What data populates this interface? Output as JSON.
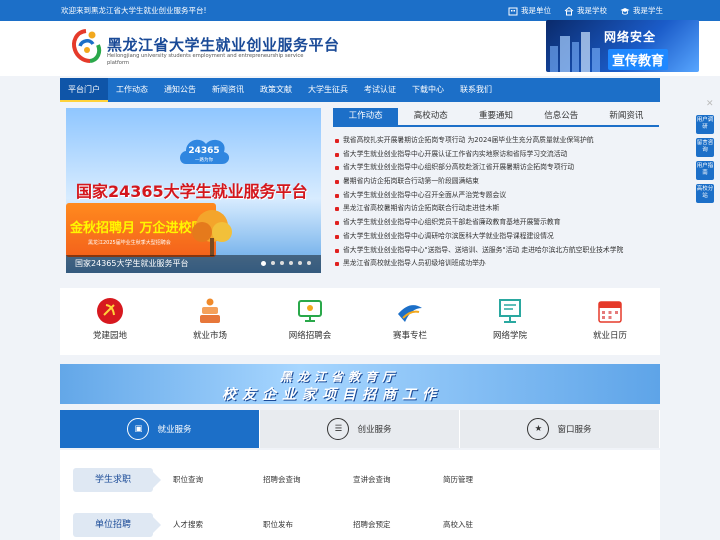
{
  "topbar": {
    "welcome": "欢迎来到黑龙江省大学生就业创业服务平台!",
    "links": [
      "我是单位",
      "我是学校",
      "我是学生"
    ]
  },
  "header": {
    "title": "黑龙江省大学生就业创业服务平台",
    "subtitle": "Heilongjiang university students employment and entrepreneurship service platform",
    "ad_line1": "网络安全",
    "ad_line2": "宣传教育"
  },
  "nav": [
    "平台门户",
    "工作动态",
    "通知公告",
    "新闻资讯",
    "政策文献",
    "大学生征兵",
    "考试认证",
    "下载中心",
    "联系我们"
  ],
  "slider": {
    "badge": "24365",
    "badge_sub": "一路为你",
    "headline": "国家24365大学生就业服务平台",
    "card_title": "金秋招聘月 万企进校园",
    "card_sub": "黑龙江2025届毕业生秋季大型招聘会",
    "caption": "国家24365大学生就业服务平台",
    "dot_count": 6,
    "active_dot": 0
  },
  "news": {
    "tabs": [
      "工作动态",
      "高校动态",
      "重要通知",
      "信息公告",
      "新闻资讯"
    ],
    "items": [
      "我省高校扎实开展暑期访企拓岗专项行动 为2024届毕业生充分高质量就业保驾护航",
      "省大学生就业创业指导中心开展认证工作省内实地察访和省际学习交流活动",
      "省大学生就业创业指导中心组织部分高校赴浙江省开展暑期访企拓岗专项行动",
      "暑期省内访企拓岗联合行动第一阶段圆满结束",
      "省大学生就业创业指导中心召开全面从严治党专题会议",
      "黑龙江省高校暑期省内访企拓岗联合行动走进佳木斯",
      "省大学生就业创业指导中心组织党员干部赴省廉政教育基地开展警示教育",
      "省大学生就业创业指导中心调研哈尔滨医科大学就业指导课程建设情况",
      "省大学生就业创业指导中心\"送指导、送培训、送服务\"活动 走进哈尔滨北方航空职业技术学院",
      "黑龙江省高校就业指导人员初级培训班成功举办"
    ]
  },
  "quick": [
    "党建园地",
    "就业市场",
    "网络招聘会",
    "赛事专栏",
    "网络学院",
    "就业日历"
  ],
  "ad2": {
    "line1": "黑龙江省教育厅",
    "line2": "校友企业家项目招商工作"
  },
  "services": {
    "tabs": [
      "就业服务",
      "创业服务",
      "窗口服务"
    ],
    "rows": [
      {
        "label": "学生求职",
        "links": [
          "职位查询",
          "招聘会查询",
          "宣讲会查询",
          "简历管理"
        ]
      },
      {
        "label": "单位招聘",
        "links": [
          "人才搜索",
          "职位发布",
          "招聘会预定",
          "高校入驻"
        ]
      }
    ]
  },
  "side": [
    "用户调研",
    "留言咨询",
    "用户指南",
    "高校分站"
  ],
  "colors": {
    "brand": "#1c6fc8",
    "accent_red": "#e0201f"
  }
}
